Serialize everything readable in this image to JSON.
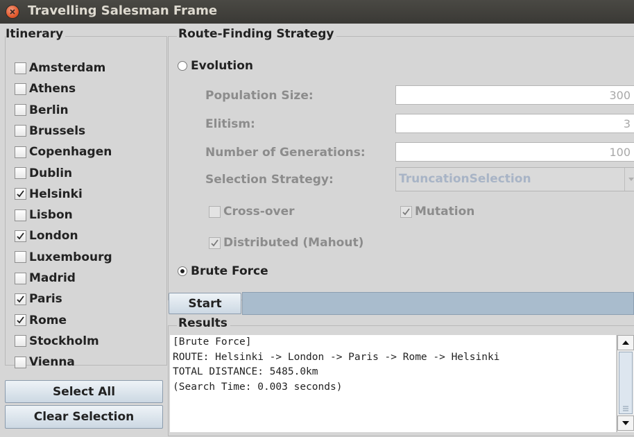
{
  "window": {
    "title": "Travelling Salesman Frame"
  },
  "itinerary": {
    "legend": "Itinerary",
    "cities": [
      {
        "label": "Amsterdam",
        "checked": false
      },
      {
        "label": "Athens",
        "checked": false
      },
      {
        "label": "Berlin",
        "checked": false
      },
      {
        "label": "Brussels",
        "checked": false
      },
      {
        "label": "Copenhagen",
        "checked": false
      },
      {
        "label": "Dublin",
        "checked": false
      },
      {
        "label": "Helsinki",
        "checked": true
      },
      {
        "label": "Lisbon",
        "checked": false
      },
      {
        "label": "London",
        "checked": true
      },
      {
        "label": "Luxembourg",
        "checked": false
      },
      {
        "label": "Madrid",
        "checked": false
      },
      {
        "label": "Paris",
        "checked": true
      },
      {
        "label": "Rome",
        "checked": true
      },
      {
        "label": "Stockholm",
        "checked": false
      },
      {
        "label": "Vienna",
        "checked": false
      }
    ],
    "select_all_label": "Select All",
    "clear_selection_label": "Clear Selection"
  },
  "strategy": {
    "legend": "Route-Finding Strategy",
    "evolution_label": "Evolution",
    "evolution_selected": false,
    "population_label": "Population Size:",
    "population_value": "300",
    "elitism_label": "Elitism:",
    "elitism_value": "3",
    "generations_label": "Number of Generations:",
    "generations_value": "100",
    "selection_label": "Selection Strategy:",
    "selection_value": "TruncationSelection",
    "crossover_label": "Cross-over",
    "crossover_checked": false,
    "mutation_label": "Mutation",
    "mutation_checked": true,
    "distributed_label": "Distributed (Mahout)",
    "distributed_checked": true,
    "brute_force_label": "Brute Force",
    "brute_force_selected": true
  },
  "controls": {
    "start_label": "Start",
    "progress": 0
  },
  "results": {
    "legend": "Results",
    "lines": [
      "[Brute Force]",
      "ROUTE: Helsinki -> London -> Paris -> Rome -> Helsinki",
      "TOTAL DISTANCE: 5485.0km",
      "(Search Time: 0.003 seconds)"
    ]
  },
  "colors": {
    "titlebar": "#3c3b37",
    "close_button": "#e05a2f",
    "button_bg": "#dfe7ee",
    "progress_bar": "#a9bccd"
  }
}
